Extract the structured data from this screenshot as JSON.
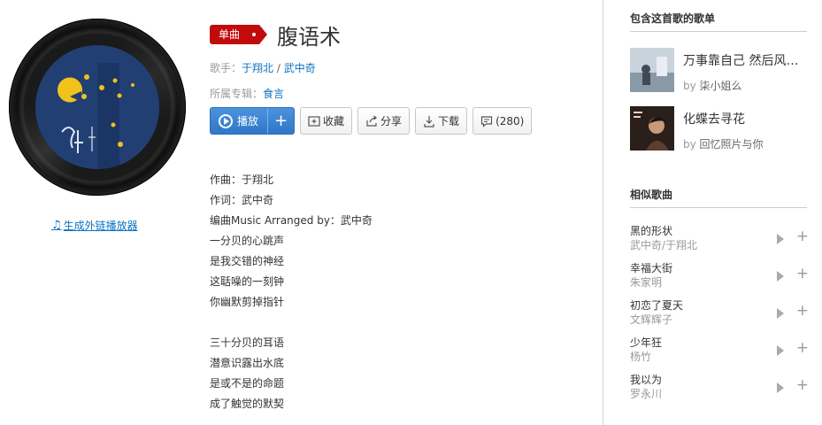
{
  "cover": {
    "ext_link_label": "生成外链播放器"
  },
  "song": {
    "tag": "单曲",
    "title": "腹语术",
    "singer_label": "歌手：",
    "singers": [
      "于翔北",
      "武中奇"
    ],
    "singer_sep": " / ",
    "album_label": "所属专辑：",
    "album": "食言"
  },
  "buttons": {
    "play": "播放",
    "plus": "+",
    "collect": "收藏",
    "share": "分享",
    "download": "下载",
    "comment_count": "(280)"
  },
  "lyrics": [
    "作曲：于翔北",
    "作词：武中奇",
    "编曲Music Arranged by：武中奇",
    "一分贝的心跳声",
    "是我交错的神经",
    "这聒噪的一刻钟",
    "你幽默剪掉指针",
    "",
    "三十分贝的耳语",
    "潜意识露出水底",
    "是或不是的命题",
    "成了触觉的默契"
  ],
  "sidebar": {
    "playlists_title": "包含这首歌的歌单",
    "playlists": [
      {
        "name": "万事靠自己 然后风…",
        "by_label": "by",
        "creator": "柒小姐么"
      },
      {
        "name": "化蝶去寻花",
        "by_label": "by",
        "creator": "回忆照片与你"
      }
    ],
    "similar_title": "相似歌曲",
    "similar": [
      {
        "name": "黑的形状",
        "artist": "武中奇/于翔北"
      },
      {
        "name": "幸福大街",
        "artist": "朱家明"
      },
      {
        "name": "初恋了夏天",
        "artist": "文辉辉子"
      },
      {
        "name": "少年狂",
        "artist": "杨竹"
      },
      {
        "name": "我以为",
        "artist": "罗永川"
      }
    ]
  },
  "colors": {
    "accent_red": "#c20c0c",
    "link_blue": "#0c73c2",
    "play_blue": "#2f77c7"
  }
}
